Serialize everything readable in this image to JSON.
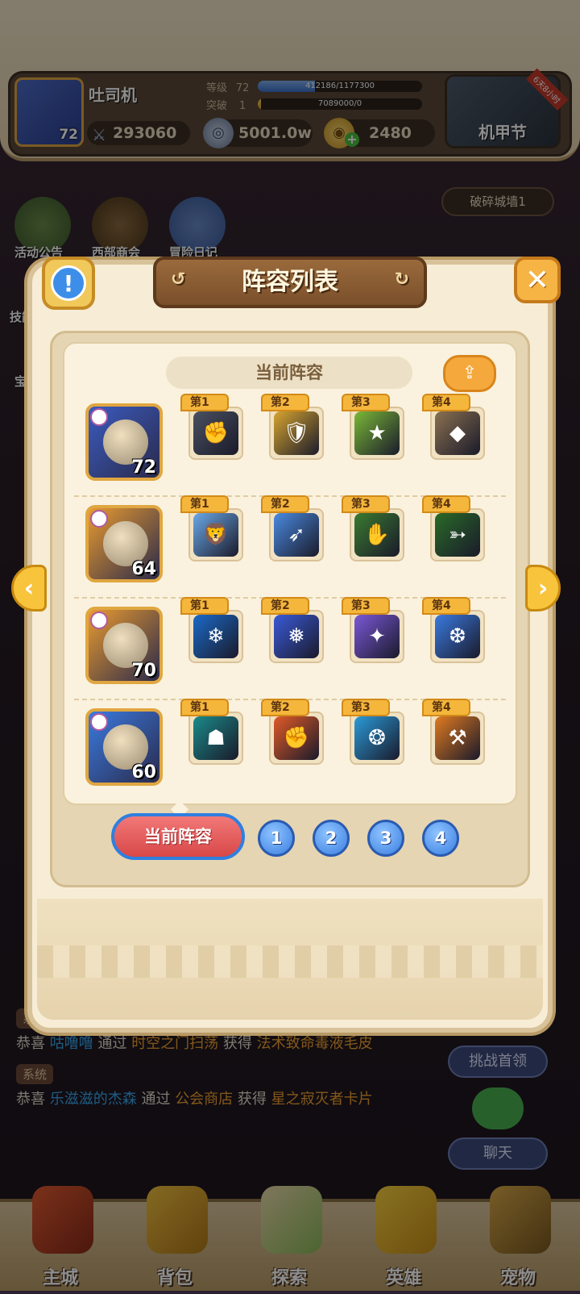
{
  "player": {
    "name": "吐司机",
    "level": "72",
    "power": "293060",
    "stats": [
      {
        "label": "等级",
        "value": "72",
        "bar_text": "412186/1177300",
        "bar_fill": 0.35
      },
      {
        "label": "突破",
        "value": "1",
        "bar_text": "7089000/0",
        "bar_fill": 0.02
      }
    ],
    "currency_1": "5001.0w",
    "currency_2": "2480"
  },
  "event": {
    "label": "机甲节",
    "ribbon": "6天8小时"
  },
  "side_icons": [
    "活动公告",
    "西部商会",
    "冒险日记"
  ],
  "left_peek": [
    "技能",
    "宝"
  ],
  "break_wall": "破碎城墙1",
  "modal": {
    "title": "阵容列表",
    "current_lineup_title": "当前阵容",
    "heroes": [
      {
        "level": "72",
        "color": "#3b5bc0",
        "skills": [
          "第1",
          "第2",
          "第3",
          "第4"
        ],
        "skill_icons": [
          "✊",
          "🛡",
          "★",
          "◆"
        ],
        "skill_colors": [
          "#4a5060",
          "#d6a430",
          "#7ab838",
          "#8a7050"
        ]
      },
      {
        "level": "64",
        "color": "#e89a30",
        "skills": [
          "第1",
          "第2",
          "第3",
          "第4"
        ],
        "skill_icons": [
          "🦁",
          "➶",
          "✋",
          "➳"
        ],
        "skill_colors": [
          "#6aa8e8",
          "#4a8ae0",
          "#3a7a30",
          "#2a6a28"
        ]
      },
      {
        "level": "70",
        "color": "#e89a30",
        "skills": [
          "第1",
          "第2",
          "第3",
          "第4"
        ],
        "skill_icons": [
          "❄",
          "❅",
          "✦",
          "❆"
        ],
        "skill_colors": [
          "#1a6ac8",
          "#3a5ad8",
          "#7a58d8",
          "#3a7ae0"
        ]
      },
      {
        "level": "60",
        "color": "#3a7ae0",
        "skills": [
          "第1",
          "第2",
          "第3",
          "第4"
        ],
        "skill_icons": [
          "☗",
          "✊",
          "❂",
          "⚒"
        ],
        "skill_colors": [
          "#1a8a8a",
          "#e05a28",
          "#2a9ad8",
          "#e07a20"
        ]
      }
    ],
    "tabs": {
      "current": "当前阵容",
      "numbers": [
        "1",
        "2",
        "3",
        "4"
      ]
    }
  },
  "chat": [
    {
      "tag": "系统",
      "parts": [
        {
          "t": "恭喜 ",
          "c": "white"
        },
        {
          "t": "咕噜噜",
          "c": "blue"
        },
        {
          "t": " 通过 ",
          "c": "white"
        },
        {
          "t": "时空之门扫荡",
          "c": "orange"
        },
        {
          "t": " 获得 ",
          "c": "white"
        },
        {
          "t": "法术致命毒液毛皮",
          "c": "orange"
        }
      ]
    },
    {
      "tag": "系统",
      "parts": [
        {
          "t": "恭喜 ",
          "c": "white"
        },
        {
          "t": "乐滋滋的杰森",
          "c": "blue"
        },
        {
          "t": " 通过 ",
          "c": "white"
        },
        {
          "t": "公会商店",
          "c": "orange"
        },
        {
          "t": " 获得 ",
          "c": "white"
        },
        {
          "t": "星之寂灭者卡片",
          "c": "orange"
        }
      ]
    }
  ],
  "right_buttons": {
    "challenge": "挑战首领",
    "chat": "聊天"
  },
  "bottom_nav": [
    "主城",
    "背包",
    "探索",
    "英雄",
    "宠物"
  ],
  "colors": {
    "accent_gold": "#f5b63c",
    "tab_active": "#d84848",
    "tab_num": "#3a7ee0"
  }
}
